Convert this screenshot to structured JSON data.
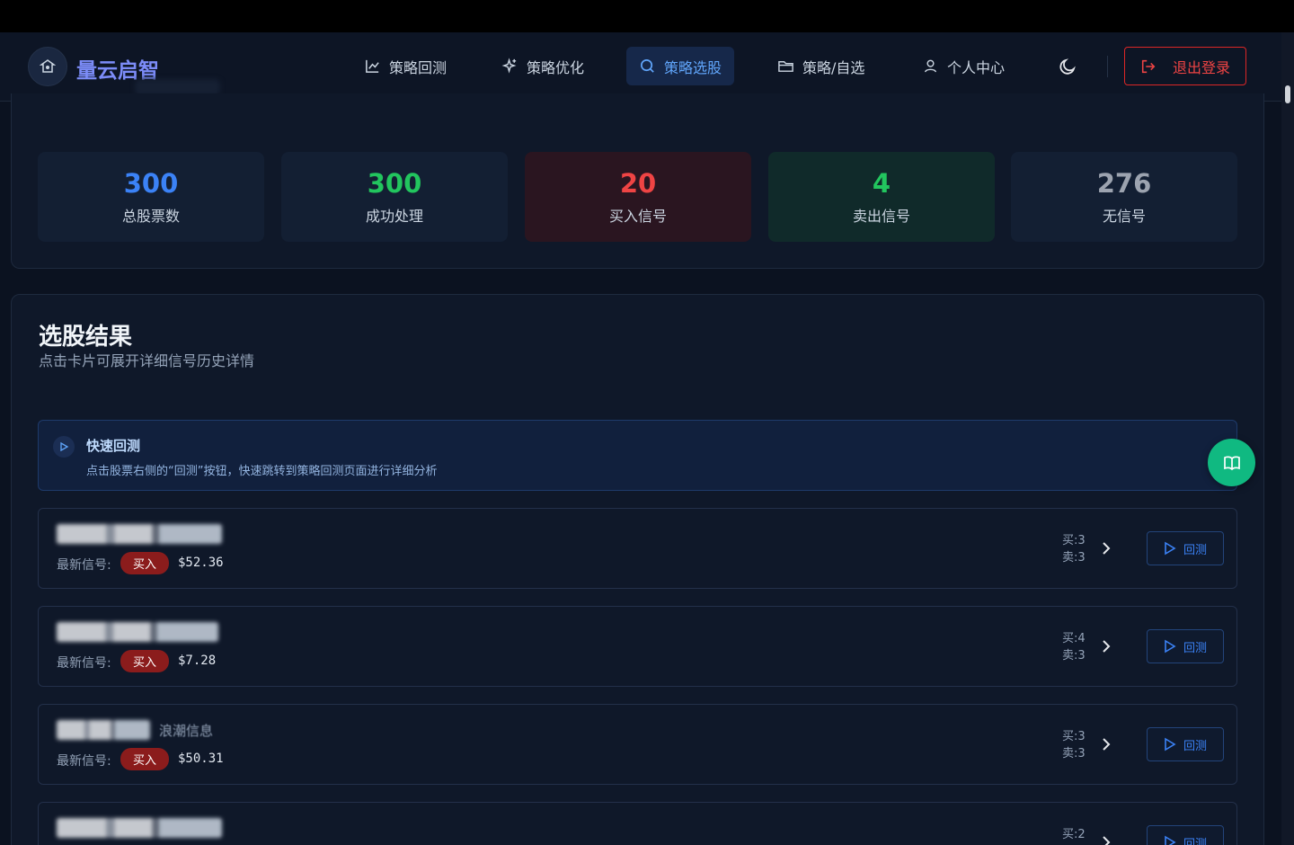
{
  "brand": {
    "name": "量云启智"
  },
  "nav": {
    "items": [
      {
        "label": "策略回测",
        "icon": "chart-line-icon"
      },
      {
        "label": "策略优化",
        "icon": "sparkles-icon"
      },
      {
        "label": "策略选股",
        "icon": "search-icon",
        "active": true
      },
      {
        "label": "策略/自选",
        "icon": "folder-icon"
      },
      {
        "label": "个人中心",
        "icon": "user-icon"
      }
    ],
    "theme_icon": "moon-icon",
    "logout_label": "退出登录"
  },
  "stats": [
    {
      "value": "300",
      "label": "总股票数",
      "color": "#3b82f6"
    },
    {
      "value": "300",
      "label": "成功处理",
      "color": "#22c55e"
    },
    {
      "value": "20",
      "label": "买入信号",
      "color": "#ef4444"
    },
    {
      "value": "4",
      "label": "卖出信号",
      "color": "#22c55e"
    },
    {
      "value": "276",
      "label": "无信号",
      "color": "#9ca3af"
    }
  ],
  "results": {
    "title": "选股结果",
    "subtitle": "点击卡片可展开详细信号历史详情",
    "tip": {
      "title": "快速回测",
      "desc": "点击股票右侧的“回测”按钮，快速跳转到策略回测页面进行详细分析"
    },
    "signal_label": "最新信号:",
    "backtest_label": "回测",
    "stocks": [
      {
        "name": "",
        "signal": "买入",
        "price": "$52.36",
        "buy": "买:3",
        "sell": "卖:3"
      },
      {
        "name": "",
        "signal": "买入",
        "price": "$7.28",
        "buy": "买:4",
        "sell": "卖:3"
      },
      {
        "name": "浪潮信息",
        "signal": "买入",
        "price": "$50.31",
        "buy": "买:3",
        "sell": "卖:3"
      },
      {
        "name": "",
        "signal": "",
        "price": "",
        "buy": "买:2",
        "sell": ""
      }
    ]
  }
}
